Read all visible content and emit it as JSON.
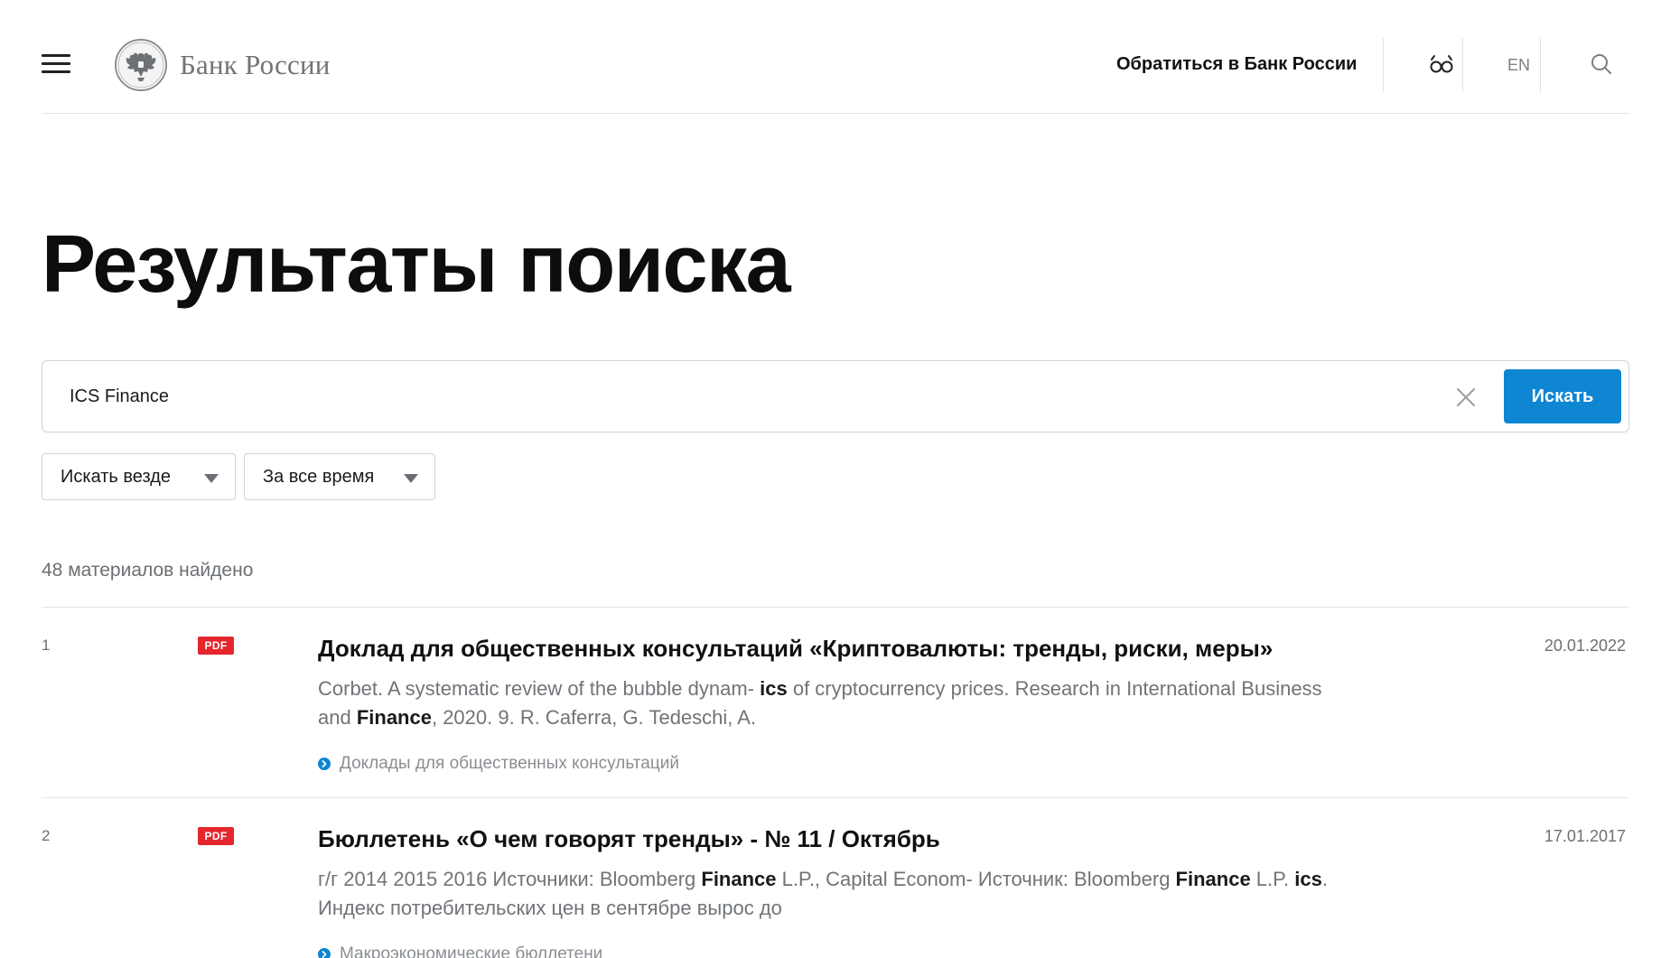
{
  "header": {
    "logo_text": "Банк России",
    "contact_label": "Обратиться в Банк России",
    "lang_label": "EN",
    "icons": {
      "menu": "hamburger-icon",
      "logo": "double-headed-eagle-emblem",
      "accessibility": "glasses-icon",
      "search": "search-icon"
    }
  },
  "page": {
    "title": "Результаты поиска"
  },
  "search": {
    "value": "ICS Finance",
    "button_label": "Искать",
    "clear_icon": "close-icon"
  },
  "filters": {
    "scope_label": "Искать везде",
    "period_label": "За все время"
  },
  "results_count": "48 материалов найдено",
  "results": [
    {
      "number": "1",
      "badge": "PDF",
      "title": "Доклад для общественных консультаций «Криптовалюты: тренды, риски, меры»",
      "date": "20.01.2022",
      "snippet": {
        "p1": "Corbet. A systematic review of the bubble dynam- ",
        "b1": "ics",
        "p2": " of cryptocurrency prices. Research in International Business and ",
        "b2": "Finance",
        "p3": ", 2020. 9. R. Caferra, G. Tedeschi, A."
      },
      "category": "Доклады для общественных консультаций"
    },
    {
      "number": "2",
      "badge": "PDF",
      "title": "Бюллетень «О чем говорят тренды» - № 11 / Октябрь",
      "date": "17.01.2017",
      "snippet": {
        "p1": "г/г 2014 2015 2016 Источники: Bloomberg ",
        "b1": "Finance",
        "p2": " L.P., Capital Econom- Источник: Bloomberg ",
        "b2": "Finance",
        "p3": " L.P. ",
        "b3": "ics",
        "p4": ". Индекс потребительских цен в сентябре вырос до"
      },
      "category": "Макроэкономические бюллетени"
    }
  ],
  "colors": {
    "accent_blue": "#0f86d1",
    "pdf_red": "#e4262d",
    "muted_text": "#707478"
  }
}
